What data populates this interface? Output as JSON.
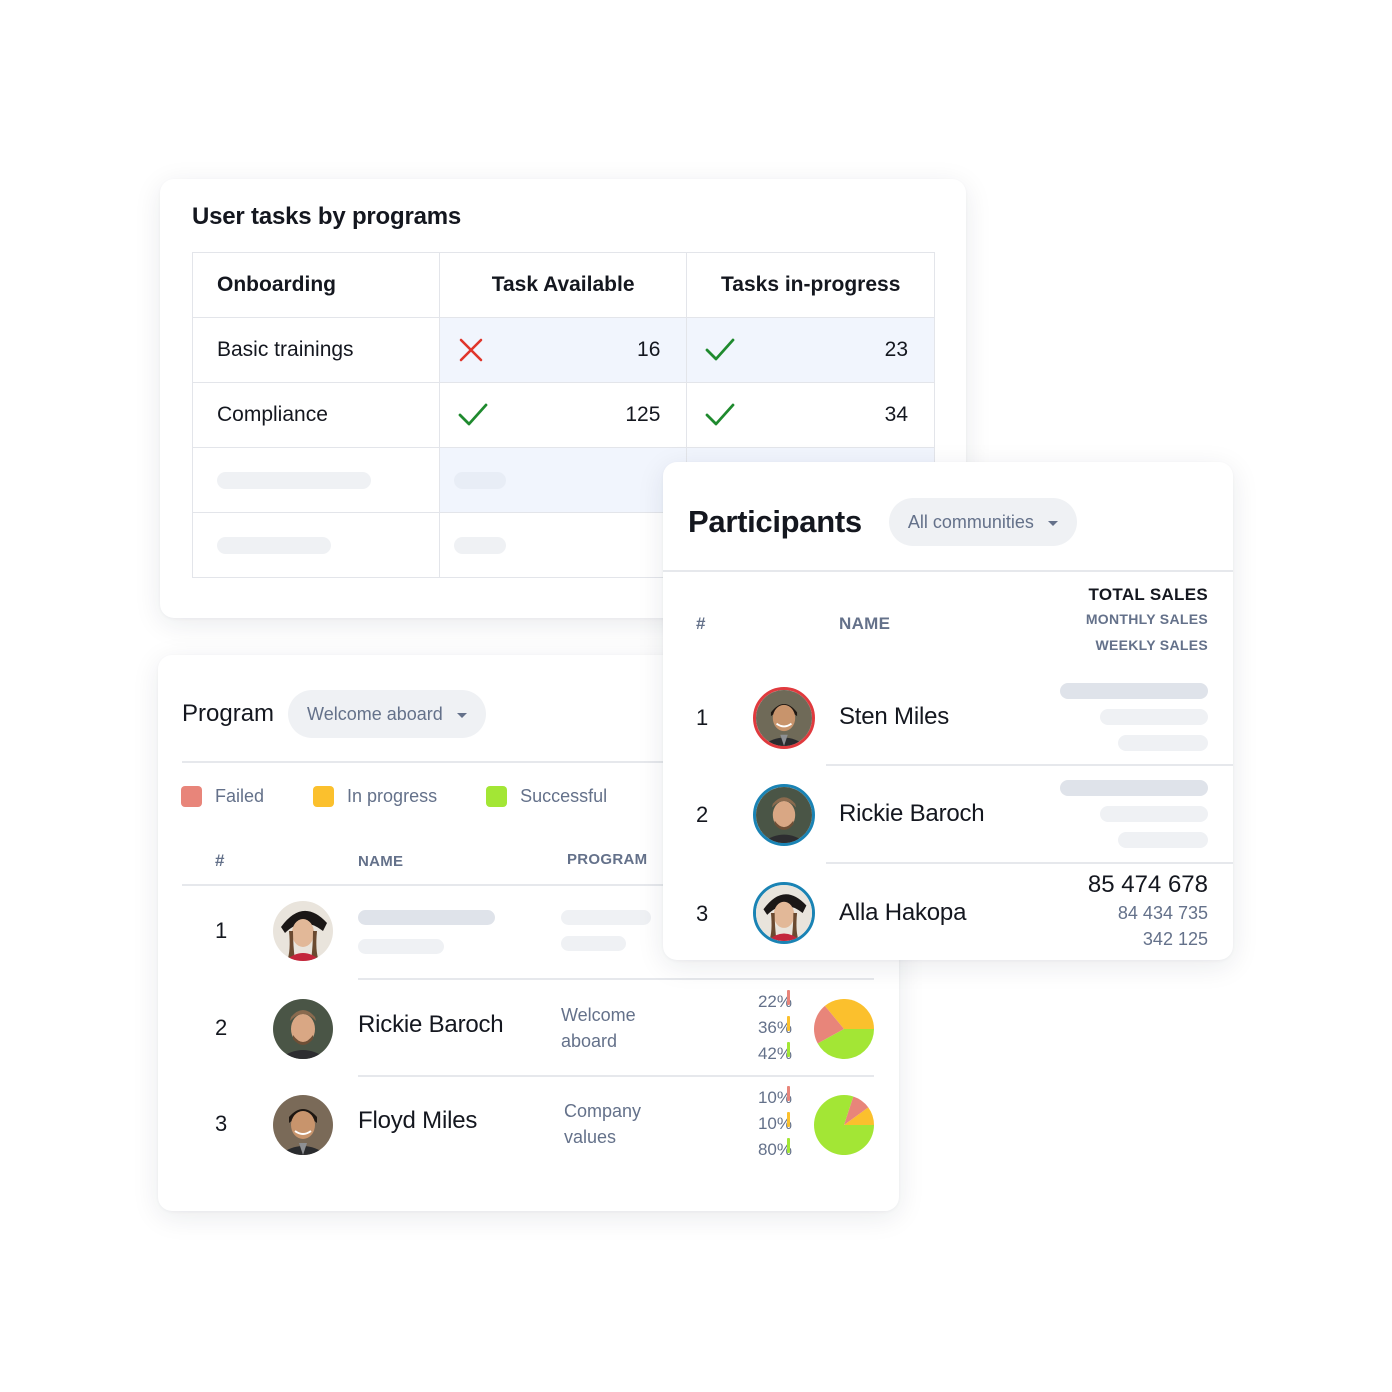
{
  "tasks_card": {
    "title": "User tasks by programs",
    "columns": [
      "Onboarding",
      "Task Available",
      "Tasks in-progress"
    ],
    "rows": [
      {
        "name": "Basic trainings",
        "available": {
          "status": "cross-icon",
          "value": "16"
        },
        "in_progress": {
          "status": "check-icon",
          "value": "23"
        }
      },
      {
        "name": "Compliance",
        "available": {
          "status": "check-icon",
          "value": "125"
        },
        "in_progress": {
          "status": "check-icon",
          "value": "34"
        }
      }
    ]
  },
  "participants_card": {
    "title": "Participants",
    "filter": {
      "selected": "All communities",
      "icon": "caret-down-icon"
    },
    "headers": {
      "index": "#",
      "name": "NAME",
      "total_sales": "TOTAL SALES",
      "monthly_sales": "MONTHLY SALES",
      "weekly_sales": "WEEKLY SALES"
    },
    "rows": [
      {
        "index": "1",
        "name": "Sten Miles",
        "ring_color": "#e03a3e"
      },
      {
        "index": "2",
        "name": "Rickie Baroch",
        "ring_color": "#1a83b4"
      },
      {
        "index": "3",
        "name": "Alla Hakopa",
        "ring_color": "#1a83b4",
        "total_sales": "85 474 678",
        "monthly_sales": "84 434 735",
        "weekly_sales": "342 125"
      }
    ]
  },
  "program_card": {
    "title": "Program",
    "filter": {
      "selected": "Welcome aboard",
      "icon": "caret-down-icon"
    },
    "legend": [
      {
        "label": "Failed",
        "color": "#e8857a"
      },
      {
        "label": "In progress",
        "color": "#fbc02d"
      },
      {
        "label": "Successful",
        "color": "#a3e635"
      }
    ],
    "headers": {
      "index": "#",
      "name": "NAME",
      "program": "PROGRAM"
    },
    "rows": [
      {
        "index": "1"
      },
      {
        "index": "2",
        "name": "Rickie Baroch",
        "program_line1": "Welcome",
        "program_line2": "aboard",
        "failed": "22%",
        "in_progress": "36%",
        "successful": "42%"
      },
      {
        "index": "3",
        "name": "Floyd Miles",
        "program_line1": "Company",
        "program_line2": "values",
        "failed": "10%",
        "in_progress": "10%",
        "successful": "80%"
      }
    ]
  },
  "chart_data": [
    {
      "type": "pie",
      "title": "Rickie Baroch – Welcome aboard",
      "labels": [
        "Failed",
        "In progress",
        "Successful"
      ],
      "values": [
        22,
        36,
        42
      ],
      "colors": [
        "#e8857a",
        "#fbc02d",
        "#a3e635"
      ]
    },
    {
      "type": "pie",
      "title": "Floyd Miles – Company values",
      "labels": [
        "Failed",
        "In progress",
        "Successful"
      ],
      "values": [
        10,
        10,
        80
      ],
      "colors": [
        "#e8857a",
        "#fbc02d",
        "#a3e635"
      ]
    }
  ]
}
